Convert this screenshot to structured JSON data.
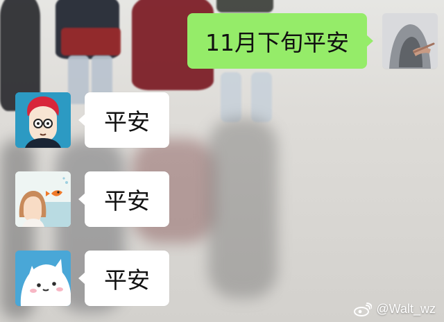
{
  "chat": {
    "sent": {
      "text": "11月下旬平安",
      "bubble_color": "#95ec69"
    },
    "replies": [
      {
        "text": "平安",
        "avatar": "anime-boy-avatar"
      },
      {
        "text": "平安",
        "avatar": "girl-goldfish-avatar"
      },
      {
        "text": "平安",
        "avatar": "cat-cartoon-avatar"
      }
    ]
  },
  "sender": {
    "avatar": "hooded-person-avatar"
  },
  "watermark": {
    "text": "@Walt_wz",
    "icon": "weibo-icon"
  }
}
